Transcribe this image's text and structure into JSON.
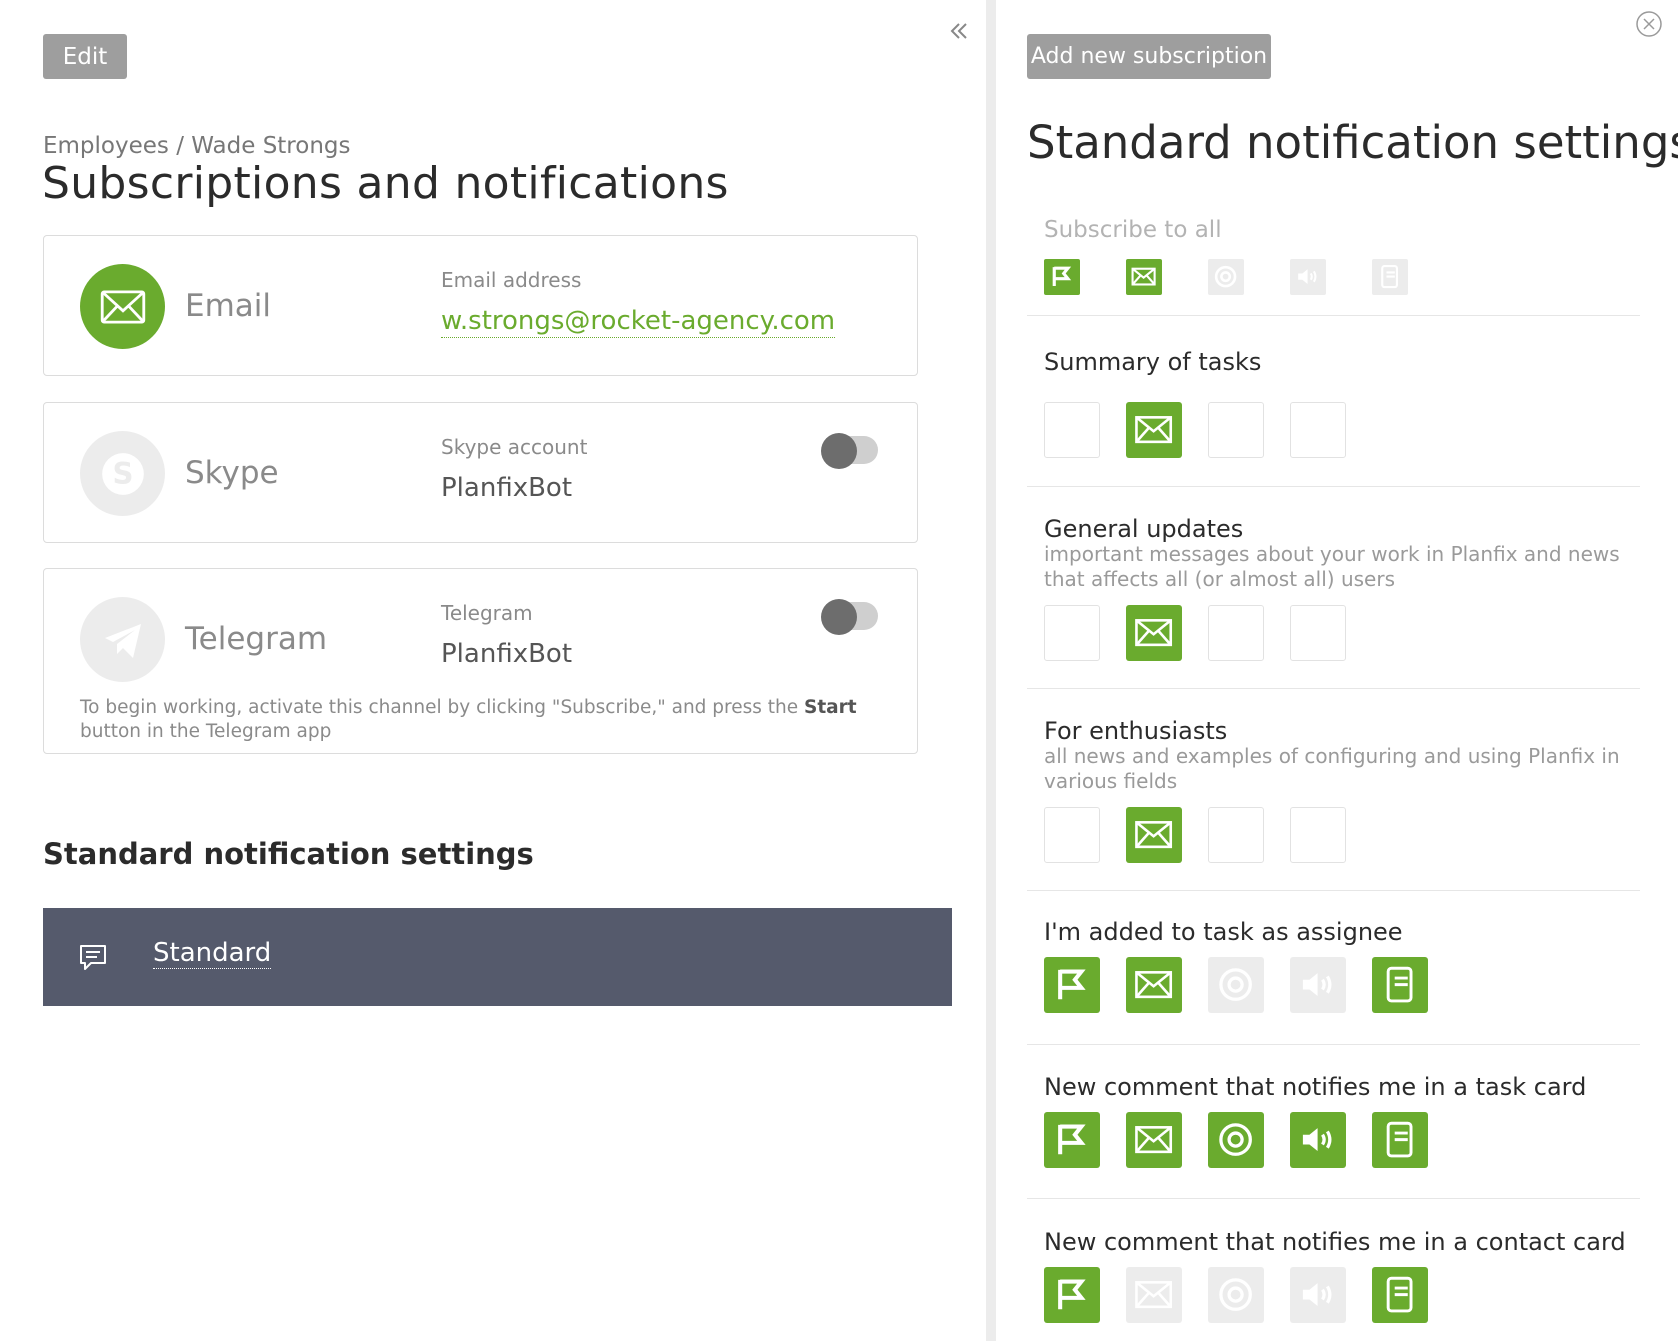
{
  "left": {
    "edit_label": "Edit",
    "breadcrumb": "Employees / Wade Strongs",
    "title": "Subscriptions and notifications",
    "channels": {
      "email": {
        "name": "Email",
        "field_label": "Email address",
        "value": "w.strongs@rocket-agency.com"
      },
      "skype": {
        "name": "Skype",
        "field_label": "Skype account",
        "value": "PlanfixBot"
      },
      "telegram": {
        "name": "Telegram",
        "field_label": "Telegram",
        "value": "PlanfixBot",
        "note_before": "To begin working, activate this channel by clicking \"Subscribe,\" and press the ",
        "note_bold": "Start",
        "note_after": " button in the Telegram app"
      }
    },
    "std_heading": "Standard notification settings",
    "std_item": "Standard"
  },
  "right": {
    "add_label": "Add new subscription",
    "title": "Standard notification settings",
    "subscribe_all": "Subscribe to all",
    "sections": [
      {
        "title": "Summary of tasks",
        "desc": ""
      },
      {
        "title": "General updates",
        "desc": "important messages about your work in Planfix and news that affects all (or almost all) users"
      },
      {
        "title": "For enthusiasts",
        "desc": "all news and examples of configuring and using Planfix in various fields"
      },
      {
        "title": "I'm added to task as assignee",
        "desc": ""
      },
      {
        "title": "New comment that notifies me in a task card",
        "desc": ""
      },
      {
        "title": "New comment that notifies me in a contact card",
        "desc": ""
      }
    ]
  },
  "colors": {
    "accent_green": "#6aab2e",
    "bar": "#555a6c",
    "button_gray": "#9e9e9e"
  }
}
